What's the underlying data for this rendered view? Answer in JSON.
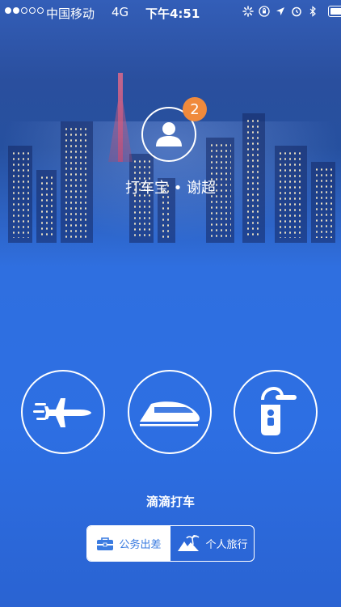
{
  "status_bar": {
    "signal_dots_filled": 2,
    "signal_dots_total": 5,
    "carrier": "中国移动",
    "network": "4G",
    "time": "下午4:51",
    "battery_level": 0.55
  },
  "profile": {
    "badge_count": "2",
    "name_line": "打车宝 • 谢超"
  },
  "services": [
    {
      "icon": "airplane-icon"
    },
    {
      "icon": "high-speed-train-icon"
    },
    {
      "icon": "hotel-door-tag-icon"
    }
  ],
  "section_title": "滴滴打车",
  "mode_switch": {
    "options": [
      {
        "label": "公务出差",
        "icon": "briefcase-icon",
        "selected": true
      },
      {
        "label": "个人旅行",
        "icon": "island-palm-icon",
        "selected": false
      }
    ]
  },
  "colors": {
    "background": "#2f6fe0",
    "badge": "#f08a3c",
    "accent": "#3a7be0"
  }
}
